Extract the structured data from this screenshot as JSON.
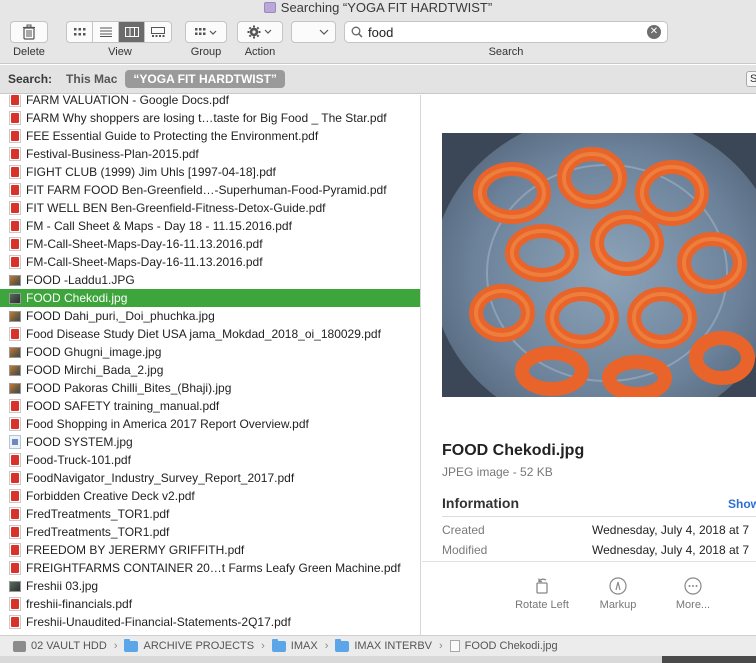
{
  "window": {
    "title": "Searching “YOGA FIT HARDTWIST”"
  },
  "toolbar": {
    "delete_label": "Delete",
    "view_label": "View",
    "group_label": "Group",
    "action_label": "Action",
    "search_label": "Search",
    "search_value": "food"
  },
  "scope": {
    "label": "Search:",
    "this_mac": "This Mac",
    "folder": "“YOGA FIT HARDTWIST”",
    "save_label": "S"
  },
  "files": [
    {
      "name": "FARM VALUATION - Google Docs.pdf",
      "icon": "pdf"
    },
    {
      "name": "FARM Why shoppers are losing t…taste for Big Food _ The Star.pdf",
      "icon": "pdf"
    },
    {
      "name": "FEE Essential Guide to Protecting the Environment.pdf",
      "icon": "pdf"
    },
    {
      "name": "Festival-Business-Plan-2015.pdf",
      "icon": "pdf"
    },
    {
      "name": "FIGHT CLUB (1999) Jim Uhls [1997-04-18].pdf",
      "icon": "pdf"
    },
    {
      "name": "FIT FARM FOOD Ben-Greenfield…-Superhuman-Food-Pyramid.pdf",
      "icon": "pdf"
    },
    {
      "name": "FIT WELL BEN Ben-Greenfield-Fitness-Detox-Guide.pdf",
      "icon": "pdf"
    },
    {
      "name": "FM - Call Sheet & Maps - Day 18 - 11.15.2016.pdf",
      "icon": "pdf"
    },
    {
      "name": "FM-Call-Sheet-Maps-Day-16-11.13.2016.pdf",
      "icon": "pdf"
    },
    {
      "name": "FM-Call-Sheet-Maps-Day-16-11.13.2016.pdf",
      "icon": "pdf"
    },
    {
      "name": "FOOD -Laddu1.JPG",
      "icon": "jpg"
    },
    {
      "name": "FOOD Chekodi.jpg",
      "icon": "jpg-dark",
      "selected": true
    },
    {
      "name": "FOOD Dahi_puri,_Doi_phuchka.jpg",
      "icon": "jpg"
    },
    {
      "name": "Food Disease Study Diet USA jama_Mokdad_2018_oi_180029.pdf",
      "icon": "pdf"
    },
    {
      "name": "FOOD Ghugni_image.jpg",
      "icon": "jpg"
    },
    {
      "name": "FOOD Mirchi_Bada_2.jpg",
      "icon": "jpg"
    },
    {
      "name": "FOOD Pakoras Chilli_Bites_(Bhaji).jpg",
      "icon": "jpg"
    },
    {
      "name": "FOOD SAFETY training_manual.pdf",
      "icon": "pdf"
    },
    {
      "name": "Food Shopping in America 2017 Report Overview.pdf",
      "icon": "pdf"
    },
    {
      "name": "FOOD SYSTEM.jpg",
      "icon": "doc"
    },
    {
      "name": "Food-Truck-101.pdf",
      "icon": "pdf"
    },
    {
      "name": "FoodNavigator_Industry_Survey_Report_2017.pdf",
      "icon": "pdf"
    },
    {
      "name": "Forbidden Creative Deck v2.pdf",
      "icon": "pdf"
    },
    {
      "name": "FredTreatments_TOR1.pdf",
      "icon": "pdf"
    },
    {
      "name": "FredTreatments_TOR1.pdf",
      "icon": "pdf"
    },
    {
      "name": "FREEDOM BY JERERMY GRIFFITH.pdf",
      "icon": "pdf"
    },
    {
      "name": "FREIGHTFARMS CONTAINER 20…t Farms Leafy Green Machine.pdf",
      "icon": "pdf"
    },
    {
      "name": "Freshii 03.jpg",
      "icon": "jpg-dark"
    },
    {
      "name": "freshii-financials.pdf",
      "icon": "pdf"
    },
    {
      "name": "Freshii-Unaudited-Financial-Statements-2Q17.pdf",
      "icon": "pdf"
    }
  ],
  "preview": {
    "title": "FOOD Chekodi.jpg",
    "subtitle": "JPEG image - 52 KB",
    "info_heading": "Information",
    "show_more": "Show",
    "created_label": "Created",
    "created_value": "Wednesday, July 4, 2018 at 7",
    "modified_label": "Modified",
    "modified_value": "Wednesday, July 4, 2018 at 7",
    "actions": {
      "rotate": "Rotate Left",
      "markup": "Markup",
      "more": "More..."
    }
  },
  "pathbar": {
    "drive": "02 VAULT HDD",
    "folder1": "ARCHIVE PROJECTS",
    "folder2": "IMAX",
    "folder3": "IMAX INTERBV",
    "file": "FOOD Chekodi.jpg"
  }
}
